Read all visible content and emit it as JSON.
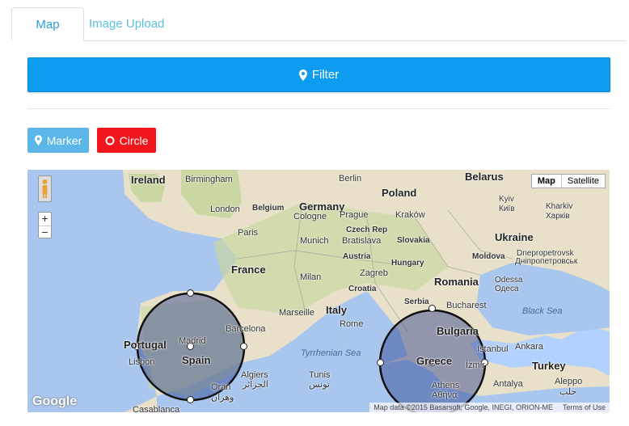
{
  "tabs": [
    {
      "label": "Map"
    },
    {
      "label": "Image Upload"
    }
  ],
  "filter": {
    "label": "Filter",
    "icon": "map-pin-icon"
  },
  "tools": {
    "marker": {
      "label": "Marker",
      "icon": "map-pin-icon"
    },
    "circle": {
      "label": "Circle",
      "icon": "circle-outline-icon"
    }
  },
  "map": {
    "maptype": {
      "map": "Map",
      "satellite": "Satellite"
    },
    "zoom": {
      "in": "+",
      "out": "−"
    },
    "logo": "Google",
    "attribution": "Map data ©2015 Basarsoft, Google, INEGI, ORION-ME",
    "terms": "Terms of Use",
    "labels": {
      "ireland": "Ireland",
      "birmingham": "Birmingham",
      "london": "London",
      "belgium": "Belgium",
      "paris": "Paris",
      "france": "France",
      "berlin": "Berlin",
      "germany": "Germany",
      "cologne": "Cologne",
      "poland": "Poland",
      "krakow": "Kraków",
      "belarus": "Belarus",
      "kyiv": "Kyiv",
      "kyiv_cyr": "Київ",
      "kharkiv": "Kharkiv",
      "kharkiv_cyr": "Харків",
      "ukraine": "Ukraine",
      "dnepro": "Dnepropetrovsk",
      "dnepro_cyr": "Дніпропетровськ",
      "prague": "Prague",
      "czech": "Czech Rep",
      "munich": "Munich",
      "bratislava": "Bratislava",
      "slovakia": "Slovakia",
      "austria": "Austria",
      "hungary": "Hungary",
      "moldova": "Moldova",
      "odessa": "Odessa",
      "odessa_cyr": "Одеса",
      "zagreb": "Zagreb",
      "croatia": "Croatia",
      "milan": "Milan",
      "romania": "Romania",
      "bucharest": "Bucharest",
      "serbia": "Serbia",
      "black_sea": "Black Sea",
      "marseille": "Marseille",
      "italy": "Italy",
      "rome": "Rome",
      "bulgaria": "Bulgaria",
      "istanbul": "Istanbul",
      "ankara": "Ankara",
      "turkey": "Turkey",
      "portugal": "Portugal",
      "madrid": "Madrid",
      "spain": "Spain",
      "barcelona": "Barcelona",
      "lisbon": "Lisbon",
      "tyrrhenian": "Tyrrhenian Sea",
      "greece": "Greece",
      "izmir": "İzmir",
      "athens": "Athens",
      "athens_gr": "Αθήνα",
      "antalya": "Antalya",
      "aleppo": "Aleppo",
      "aleppo_ar": "حلب",
      "algiers": "Algiers",
      "algiers_ar": "الجزائر",
      "tunis": "Tunis",
      "tunis_ar": "تونس",
      "oran": "Oran",
      "oran_ar": "وهران",
      "casablanca": "Casablanca"
    }
  },
  "colors": {
    "filter": "#0d9cf0",
    "marker": "#5bb7e8",
    "circle": "#f0161c",
    "tab": "#5bc0de"
  }
}
